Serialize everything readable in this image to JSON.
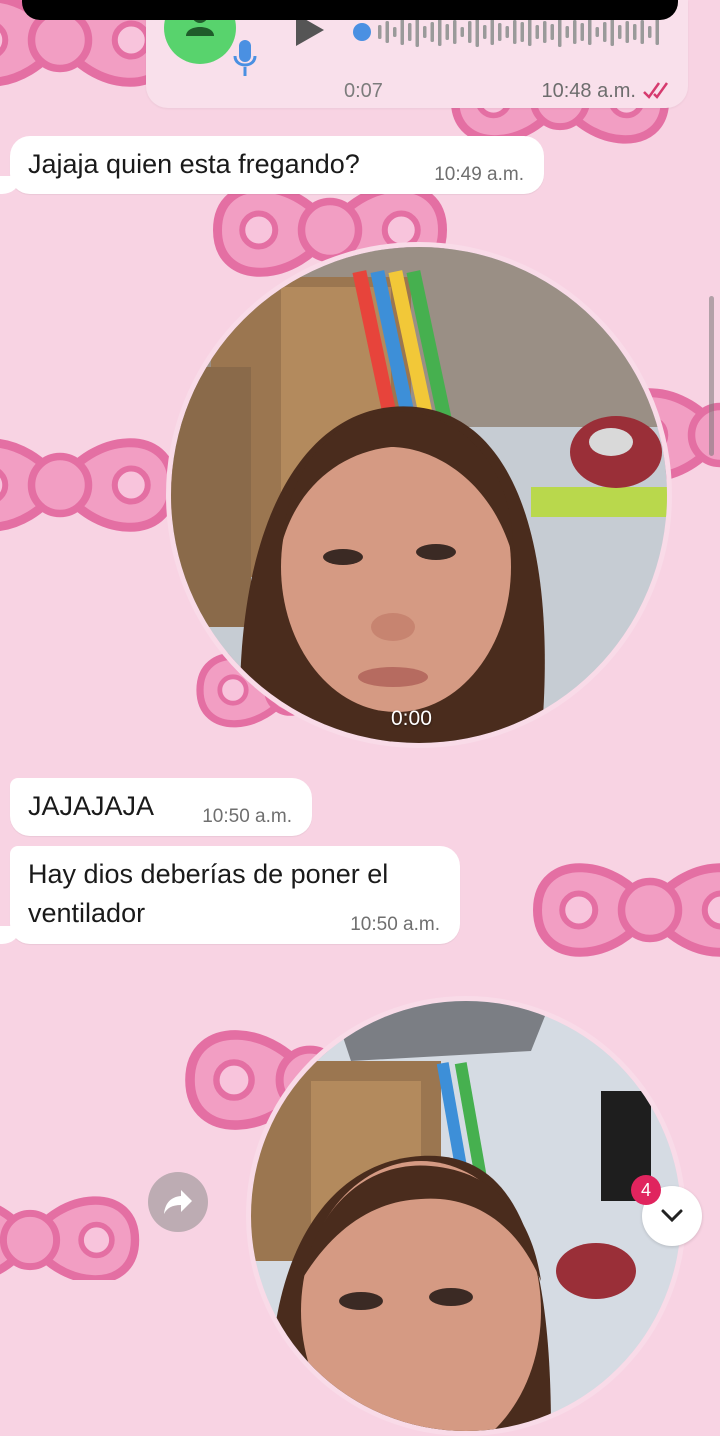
{
  "voice_message": {
    "duration": "0:07",
    "time": "10:48 a.m."
  },
  "messages": [
    {
      "text": "Jajaja quien esta fregando?",
      "time": "10:49 a.m."
    },
    {
      "text": "JAJAJAJA",
      "time": "10:50 a.m."
    },
    {
      "text_line1": "Hay dios deberías de poner el",
      "text_line2": "ventilador",
      "time": "10:50 a.m."
    }
  ],
  "video_note_1": {
    "duration": "0:00"
  },
  "unread_count": "4",
  "icons": {
    "avatar": "person-icon",
    "mic": "microphone-icon",
    "play": "play-icon",
    "ticks": "double-check-icon",
    "share": "forward-arrow-icon",
    "scroll": "chevron-down-icon"
  },
  "colors": {
    "wallpaper": "#f8d3e3",
    "bow": "#f29ec3",
    "bow_outline": "#e46fa3",
    "avatar": "#58d36d",
    "badge": "#e0245e",
    "ticks": "#d63a6e"
  }
}
